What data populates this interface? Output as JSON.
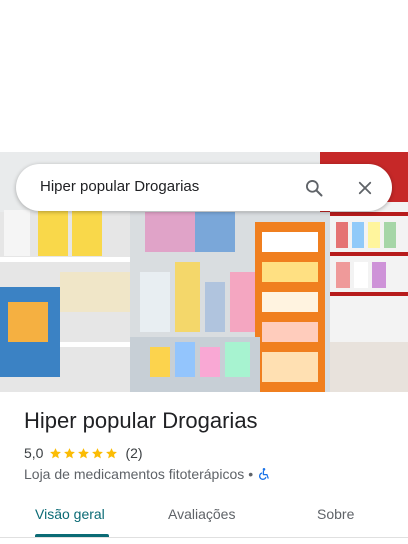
{
  "search": {
    "query": "Hiper popular Drogarias"
  },
  "place": {
    "name": "Hiper popular Drogarias",
    "rating": "5,0",
    "stars": 5,
    "review_count": "(2)",
    "category": "Loja de medicamentos fitoterápicos",
    "separator": "•"
  },
  "tabs": [
    {
      "label": "Visão geral",
      "active": true
    },
    {
      "label": "Avaliações",
      "active": false
    },
    {
      "label": "Sobre",
      "active": false
    }
  ],
  "colors": {
    "accent": "#0b6b75",
    "star": "#fbbc04",
    "accessibility": "#1a73e8"
  },
  "icons": [
    "search-icon",
    "close-icon",
    "star-icon",
    "wheelchair-icon"
  ]
}
